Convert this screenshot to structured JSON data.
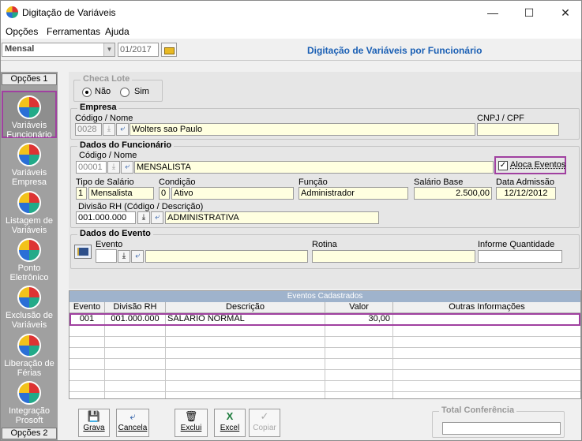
{
  "window": {
    "title": "Digitação de Variáveis"
  },
  "menu": [
    "Opções",
    "Ferramentas",
    "Ajuda"
  ],
  "toolbar": {
    "period_value": "Mensal",
    "month_value": "01/2017"
  },
  "header": {
    "title": "Digitação de Variáveis por Funcionário"
  },
  "sidebar": {
    "top_label": "Opções 1",
    "bottom_label": "Opções 2",
    "items": [
      {
        "label": "Variáveis Funcionário",
        "active": true
      },
      {
        "label": "Variáveis Empresa"
      },
      {
        "label": "Listagem de Variáveis"
      },
      {
        "label": "Ponto Eletrônico"
      },
      {
        "label": "Exclusão de Variáveis"
      },
      {
        "label": "Liberação de Férias"
      },
      {
        "label": "Integração Prosoft"
      }
    ]
  },
  "checa_lote": {
    "title": "Checa Lote",
    "option_nao": "Não",
    "option_sim": "Sim",
    "selected": "Não"
  },
  "empresa": {
    "title": "Empresa",
    "code_label": "Código / Nome",
    "code": "0028",
    "name": "Wolters sao Paulo",
    "cnpj_label": "CNPJ / CPF",
    "cnpj": ""
  },
  "funcionario": {
    "title": "Dados do Funcionário",
    "code_label": "Código / Nome",
    "code": "00001",
    "name": "MENSALISTA",
    "aloca_label": "Aloca Eventos",
    "aloca_checked": true,
    "tipo_label": "Tipo de Salário",
    "tipo_code": "1",
    "tipo_value": "Mensalista",
    "condicao_label": "Condição",
    "condicao_code": "0",
    "condicao_value": "Ativo",
    "funcao_label": "Função",
    "funcao_value": "Administrador",
    "salario_label": "Salário Base",
    "salario_value": "2.500,00",
    "admissao_label": "Data Admissão",
    "admissao_value": "12/12/2012",
    "divisao_label": "Divisão RH (Código / Descrição)",
    "divisao_code": "001.000.000",
    "divisao_value": "ADMINISTRATIVA"
  },
  "evento": {
    "title": "Dados do Evento",
    "evento_label": "Evento",
    "rotina_label": "Rotina",
    "quantidade_label": "Informe Quantidade"
  },
  "grid": {
    "title": "Eventos Cadastrados",
    "columns": [
      "Evento",
      "Divisão RH",
      "Descrição",
      "Valor",
      "Outras Informações"
    ],
    "rows": [
      {
        "evento": "001",
        "divisao": "001.000.000",
        "descricao": "SALÁRIO NORMAL",
        "valor": "30,00",
        "outras": ""
      }
    ]
  },
  "buttons": {
    "grava": "Grava",
    "cancela": "Cancela",
    "exclui": "Exclui",
    "excel": "Excel",
    "copiar": "Copiar"
  },
  "total": {
    "title": "Total Conferência",
    "value": ""
  },
  "colors": {
    "accent": "#1a5fb4",
    "highlight": "#a040a0",
    "field": "#ffffe0"
  }
}
